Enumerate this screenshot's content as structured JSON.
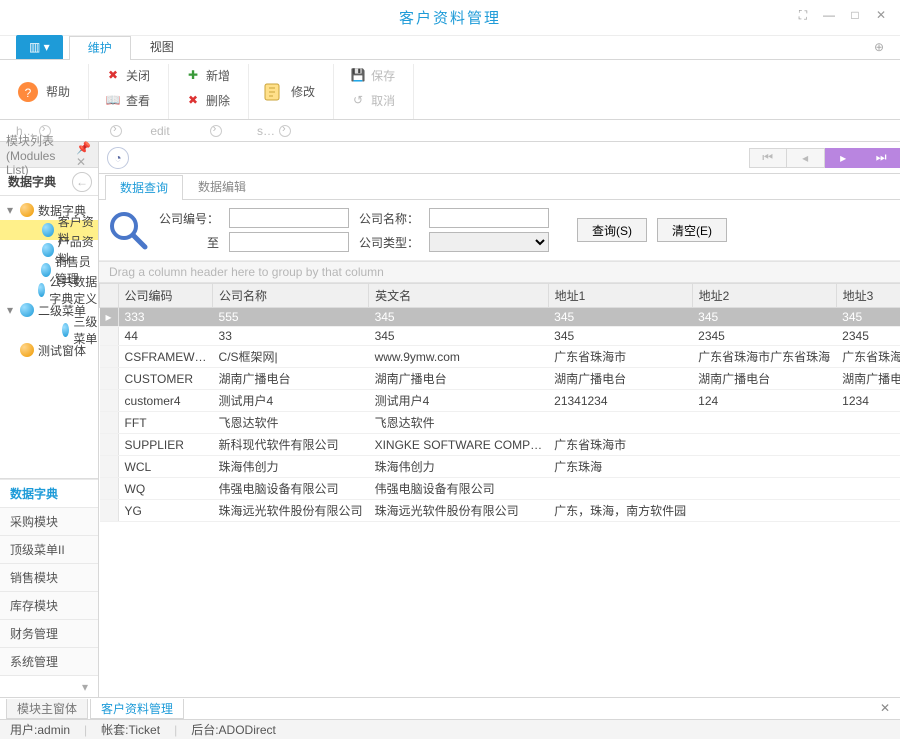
{
  "window": {
    "title": "客户资料管理"
  },
  "ribbon": {
    "tabs": [
      "维护",
      "视图"
    ],
    "help": "帮助",
    "close": "关闭",
    "view": "查看",
    "add": "新增",
    "delete": "删除",
    "modify": "修改",
    "save": "保存",
    "cancel": "取消",
    "caps": [
      "h…",
      "edit",
      "s…"
    ]
  },
  "sidebar": {
    "panel_title": "模块列表(Modules List)",
    "active_group": "数据字典",
    "tree": [
      {
        "label": "数据字典",
        "level": 1,
        "expand": "▾",
        "orange": true
      },
      {
        "label": "客户资料",
        "level": 2,
        "selected": true
      },
      {
        "label": "产品资料",
        "level": 2
      },
      {
        "label": "销售员管理",
        "level": 2
      },
      {
        "label": "公共数据字典定义",
        "level": 2
      },
      {
        "label": "二级菜单",
        "level": 1,
        "expand": "▾"
      },
      {
        "label": "三级菜单",
        "level": 3
      },
      {
        "label": "测试窗体",
        "level": 1,
        "orange": true,
        "noexp": true
      }
    ],
    "groups": [
      "数据字典",
      "采购模块",
      "顶级菜单II",
      "销售模块",
      "库存模块",
      "财务管理",
      "系统管理"
    ]
  },
  "content": {
    "inner_tabs": {
      "active": "数据查询",
      "other": "数据编辑"
    },
    "search": {
      "code_lbl": "公司编号：",
      "name_lbl": "公司名称：",
      "to_lbl": "至",
      "type_lbl": "公司类型：",
      "btn_query": "查询(S)",
      "btn_clear": "清空(E)"
    },
    "group_hint": "Drag a column header here to group by that column",
    "columns": [
      "公司编码",
      "公司名称",
      "英文名",
      "地址1",
      "地址2",
      "地址3"
    ],
    "rows": [
      [
        "333",
        "555",
        "345",
        "345",
        "345",
        "345"
      ],
      [
        "44",
        "33",
        "345",
        "345",
        "2345",
        "2345"
      ],
      [
        "CSFRAMEW…",
        "C/S框架网|",
        "www.9ymw.com",
        "广东省珠海市",
        "广东省珠海市广东省珠海",
        "广东省珠海"
      ],
      [
        "CUSTOMER",
        "湖南广播电台",
        "湖南广播电台",
        "湖南广播电台",
        "湖南广播电台",
        "湖南广播电"
      ],
      [
        "customer4",
        "测试用户4",
        "测试用户4",
        "21341234",
        "124",
        "1234"
      ],
      [
        "FFT",
        "飞恩达软件",
        "飞恩达软件",
        "",
        "",
        ""
      ],
      [
        "SUPPLIER",
        "新科现代软件有限公司",
        "XINGKE SOFTWARE COMP…",
        "广东省珠海市",
        "",
        ""
      ],
      [
        "WCL",
        "珠海伟创力",
        "珠海伟创力",
        "广东珠海",
        "",
        ""
      ],
      [
        "WQ",
        "伟强电脑设备有限公司",
        "伟强电脑设备有限公司",
        "",
        "",
        ""
      ],
      [
        "YG",
        "珠海远光软件股份有限公司",
        "珠海远光软件股份有限公司",
        "广东，珠海，南方软件园",
        "",
        ""
      ]
    ]
  },
  "doc_tabs": {
    "a": "模块主窗体",
    "b": "客户资料管理"
  },
  "status": {
    "user_lbl": "用户:",
    "user": "admin",
    "acct_lbl": "帐套:",
    "acct": "Ticket",
    "ds_lbl": "后台:",
    "ds": "ADODirect"
  }
}
